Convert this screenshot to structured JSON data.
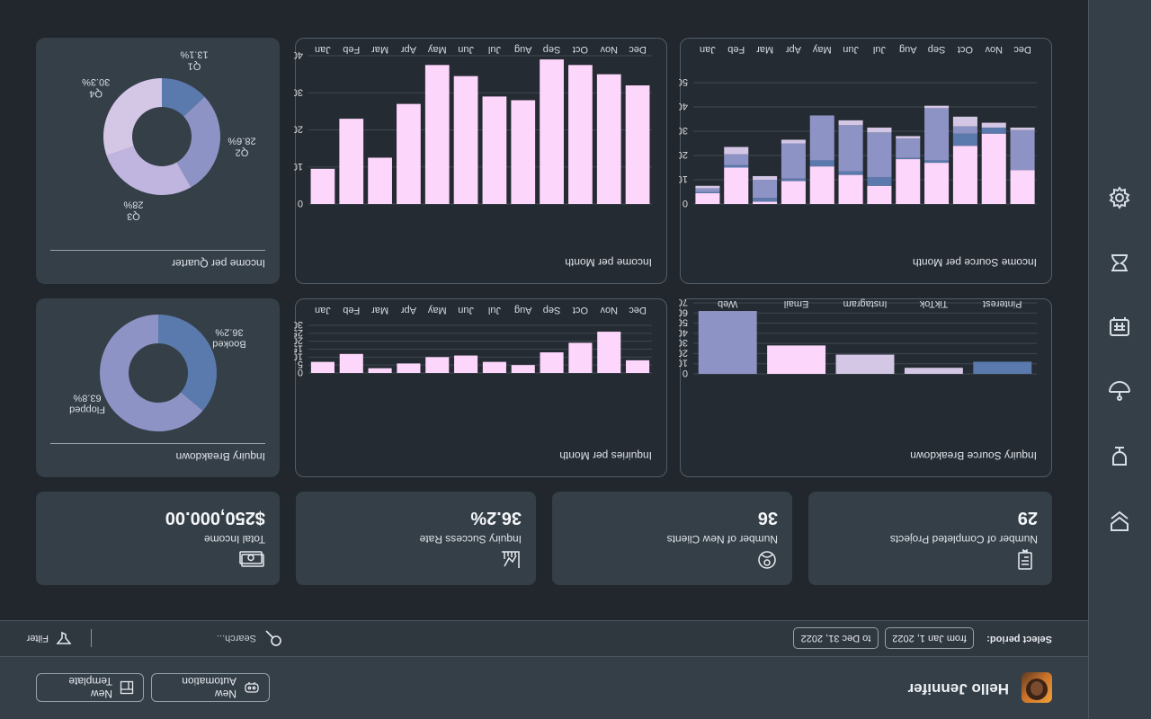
{
  "user": {
    "greeting": "Hello Jennifer"
  },
  "toolbar": {
    "new_template": "New Template",
    "new_automation": "New Automation"
  },
  "filters": {
    "select_period": "Select period:",
    "from": "from Jan 1, 2022",
    "to": "to Dec 31, 2022",
    "search_placeholder": "Search...",
    "filter_label": "Filter"
  },
  "stats": [
    {
      "label": "Total Income",
      "value": "$250,000.00",
      "icon": "money-icon"
    },
    {
      "label": "Inquiry Success Rate",
      "value": "36.2%",
      "icon": "chart-icon"
    },
    {
      "label": "Number of New Clients",
      "value": "36",
      "icon": "client-icon"
    },
    {
      "label": "Number of Completed Projects",
      "value": "29",
      "icon": "document-icon"
    }
  ],
  "sidebar": {
    "icons": [
      "bookmark-icon",
      "bell-icon",
      "dashboard-icon",
      "calendar-icon",
      "user-icon",
      "settings-icon"
    ]
  },
  "colors": {
    "light": "#fdd6fb",
    "blue": "#5a79ac",
    "lavender": "#8e93c5",
    "pale": "#d4c7e6",
    "pale2": "#bfb5de"
  },
  "chart_data": [
    {
      "type": "pie",
      "title": "Inquiry Breakdown",
      "slices": [
        {
          "label": "Booked",
          "value": 36.2,
          "text": "36.2%",
          "color": "#5a79ac"
        },
        {
          "label": "Flopped",
          "value": 63.8,
          "text": "63.8%",
          "color": "#8e93c5"
        }
      ]
    },
    {
      "type": "bar",
      "title": "Inquiries per Month",
      "categories": [
        "Jan",
        "Feb",
        "Mar",
        "Apr",
        "May",
        "Jun",
        "Jul",
        "Aug",
        "Sep",
        "Oct",
        "Nov",
        "Dec"
      ],
      "values": [
        7,
        12,
        3,
        6,
        10,
        11,
        7,
        5,
        13,
        19,
        26,
        8
      ],
      "yticks": [
        0,
        5,
        10,
        15,
        20,
        25,
        30
      ],
      "ylim": [
        0,
        30
      ]
    },
    {
      "type": "bar",
      "title": "Inquiry Source Breakdown",
      "categories": [
        "Web",
        "Email",
        "Instagram",
        "TikTok",
        "Pinterest"
      ],
      "values": [
        62,
        28,
        19,
        6,
        12
      ],
      "colors": [
        "#8e93c5",
        "#fdd6fb",
        "#d4c7e6",
        "#d4c7e6",
        "#5a79ac"
      ],
      "yticks": [
        0,
        10,
        20,
        30,
        40,
        50,
        60,
        70
      ],
      "ylim": [
        0,
        70
      ]
    },
    {
      "type": "pie",
      "title": "Income per Quarter",
      "slices": [
        {
          "label": "Q1",
          "value": 13.1,
          "text": "13.1%",
          "color": "#5a79ac"
        },
        {
          "label": "Q2",
          "value": 28.6,
          "text": "28.6%",
          "color": "#8e93c5"
        },
        {
          "label": "Q3",
          "value": 28,
          "text": "28%",
          "color": "#bfb5de"
        },
        {
          "label": "Q4",
          "value": 30.3,
          "text": "30.3%",
          "color": "#d4c7e6"
        }
      ]
    },
    {
      "type": "bar",
      "title": "Income per Month",
      "categories": [
        "Jan",
        "Feb",
        "Mar",
        "Apr",
        "May",
        "Jun",
        "Jul",
        "Aug",
        "Sep",
        "Oct",
        "Nov",
        "Dec"
      ],
      "values": [
        9500,
        23000,
        12500,
        27000,
        37500,
        34500,
        29000,
        28000,
        39000,
        37500,
        35000,
        32000
      ],
      "yticks": [
        0,
        10000,
        20000,
        30000,
        40000
      ],
      "ylim": [
        0,
        40000
      ]
    },
    {
      "type": "bar",
      "title": "Income Source per Month",
      "stacked": true,
      "categories": [
        "Jan",
        "Feb",
        "Mar",
        "Apr",
        "May",
        "Jun",
        "Jul",
        "Aug",
        "Sep",
        "Oct",
        "Nov",
        "Dec"
      ],
      "series": [
        {
          "name": "",
          "color": "#fdd6fb",
          "values": [
            4500,
            15000,
            1000,
            9500,
            15500,
            12000,
            7500,
            18500,
            17000,
            24000,
            29000,
            14000
          ]
        },
        {
          "name": "",
          "color": "#5a79ac",
          "values": [
            500,
            1000,
            1500,
            1000,
            2500,
            1500,
            3500,
            500,
            1000,
            5000,
            2500,
            0
          ]
        },
        {
          "name": "",
          "color": "#8e93c5",
          "values": [
            1500,
            4500,
            7500,
            14500,
            18500,
            19000,
            18500,
            8000,
            21500,
            3000,
            0,
            16500
          ]
        },
        {
          "name": "",
          "color": "#d4c7e6",
          "values": [
            1000,
            3000,
            1500,
            1500,
            0,
            2000,
            2000,
            1000,
            1000,
            4000,
            2000,
            1000
          ]
        }
      ],
      "yticks": [
        0,
        10000,
        20000,
        30000,
        40000,
        50000
      ],
      "ylim": [
        0,
        50000
      ]
    }
  ]
}
